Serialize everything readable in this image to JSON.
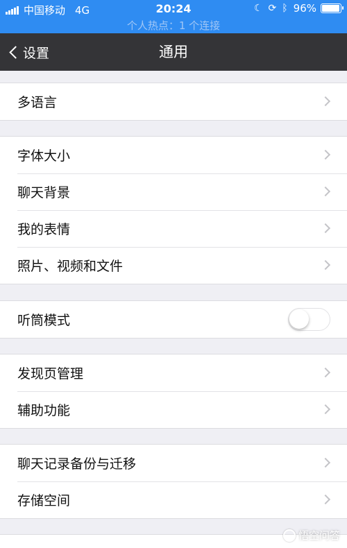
{
  "status_bar": {
    "carrier": "中国移动",
    "network": "4G",
    "time": "20:24",
    "battery_percent": "96%",
    "battery_level": 0.96,
    "icons": [
      "signal-icon",
      "moon-icon",
      "rotation-lock-icon",
      "bluetooth-icon",
      "battery-icon"
    ],
    "hotspot_text": "个人热点：1 个连接",
    "background_color": "#2f8cf2"
  },
  "nav": {
    "back_label": "设置",
    "title": "通用",
    "background_color": "#343437"
  },
  "groups": [
    {
      "items": [
        {
          "label": "多语言",
          "accessory": "chevron"
        }
      ]
    },
    {
      "items": [
        {
          "label": "字体大小",
          "accessory": "chevron"
        },
        {
          "label": "聊天背景",
          "accessory": "chevron"
        },
        {
          "label": "我的表情",
          "accessory": "chevron"
        },
        {
          "label": "照片、视频和文件",
          "accessory": "chevron"
        }
      ]
    },
    {
      "items": [
        {
          "label": "听筒模式",
          "accessory": "toggle",
          "toggle_on": false
        }
      ]
    },
    {
      "items": [
        {
          "label": "发现页管理",
          "accessory": "chevron"
        },
        {
          "label": "辅助功能",
          "accessory": "chevron"
        }
      ]
    },
    {
      "items": [
        {
          "label": "聊天记录备份与迁移",
          "accessory": "chevron"
        },
        {
          "label": "存储空间",
          "accessory": "chevron"
        }
      ]
    }
  ],
  "watermark": "悟空问答"
}
